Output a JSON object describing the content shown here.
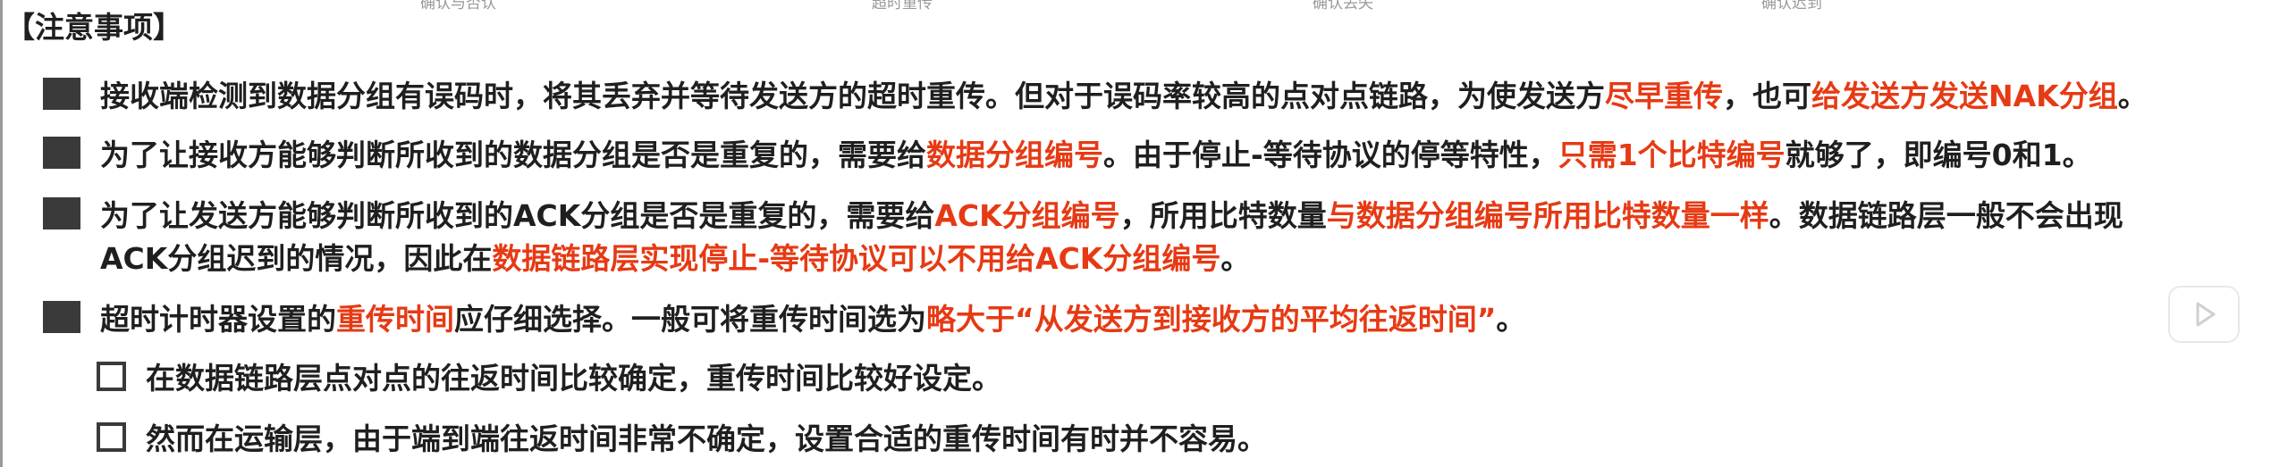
{
  "header_faint": [
    "确认与否认",
    "超时重传",
    "确认丢失",
    "确认迟到"
  ],
  "title": "【注意事项】",
  "items": [
    {
      "lines": [
        [
          {
            "t": "接收端检测到数据分组有误码时，将其丢弃并等待发送方的超时重传。但对于误码率较高的点对点链路，为使发送方",
            "r": false
          },
          {
            "t": "尽早重传",
            "r": true
          },
          {
            "t": "，也可",
            "r": false
          },
          {
            "t": "给发送方发送NAK分组",
            "r": true
          },
          {
            "t": "。",
            "r": false
          }
        ]
      ]
    },
    {
      "lines": [
        [
          {
            "t": "为了让接收方能够判断所收到的数据分组是否是重复的，需要给",
            "r": false
          },
          {
            "t": "数据分组编号",
            "r": true
          },
          {
            "t": "。由于停止-等待协议的停等特性，",
            "r": false
          },
          {
            "t": "只需1个比特编号",
            "r": true
          },
          {
            "t": "就够了，即编号0和1。",
            "r": false
          }
        ]
      ]
    },
    {
      "lines": [
        [
          {
            "t": "为了让发送方能够判断所收到的ACK分组是否是重复的，需要给",
            "r": false
          },
          {
            "t": "ACK分组编号",
            "r": true
          },
          {
            "t": "，所用比特数量",
            "r": false
          },
          {
            "t": "与数据分组编号所用比特数量一样",
            "r": true
          },
          {
            "t": "。数据链路层一般不会出现",
            "r": false
          }
        ],
        [
          {
            "t": "ACK分组迟到的情况，因此在",
            "r": false
          },
          {
            "t": "数据链路层实现停止-等待协议可以不用给ACK分组编号",
            "r": true
          },
          {
            "t": "。",
            "r": false
          }
        ]
      ]
    },
    {
      "lines": [
        [
          {
            "t": "超时计时器设置的",
            "r": false
          },
          {
            "t": "重传时间",
            "r": true
          },
          {
            "t": "应仔细选择。一般可将重传时间选为",
            "r": false
          },
          {
            "t": "略大于“从发送方到接收方的平均往返时间”",
            "r": true
          },
          {
            "t": "。",
            "r": false
          }
        ]
      ]
    }
  ],
  "subitems": [
    "在数据链路层点对点的往返时间比较确定，重传时间比较好设定。",
    "然而在运输层，由于端到端往返时间非常不确定，设置合适的重传时间有时并不容易。"
  ],
  "colors": {
    "text": "#1f1f1f",
    "emphasis": "#e63a14",
    "bullet": "#3a3a3a"
  },
  "icons": {
    "overlay": "play-icon"
  }
}
